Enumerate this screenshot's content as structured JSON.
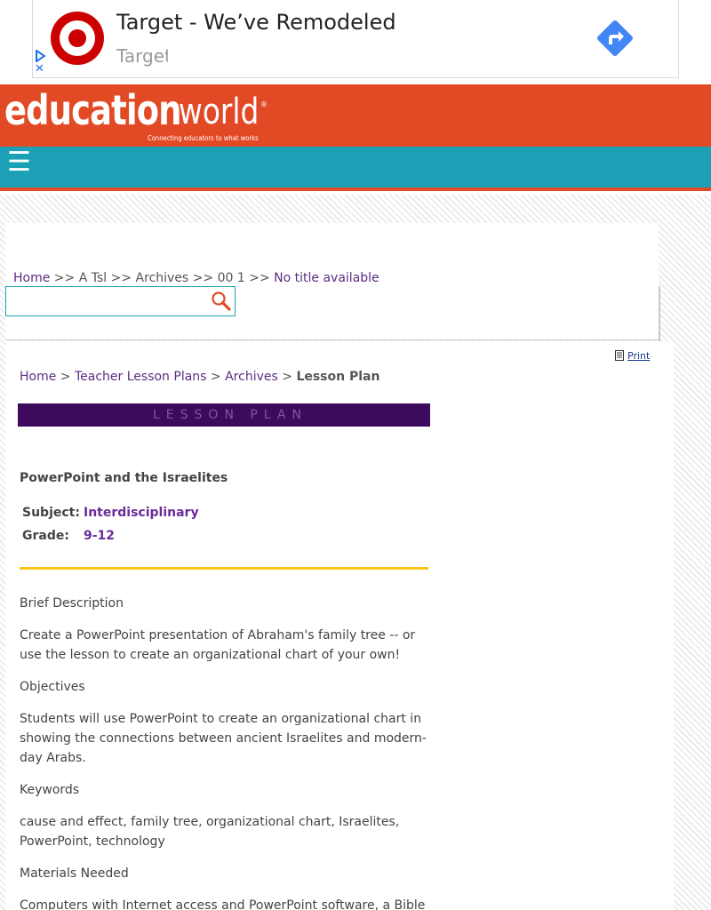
{
  "ad": {
    "title": "Target - We’ve Remodeled",
    "subtitle": "Target",
    "close_glyph": "✕",
    "brand_color": "#cc0000",
    "direction_color": "#4285f4"
  },
  "header": {
    "logo_primary": "education",
    "logo_secondary": "world",
    "logo_reg": "®",
    "tagline": "Connecting educators to what works",
    "menu_glyph": "☰"
  },
  "top_breadcrumb": {
    "home": "Home",
    "sep": ">>",
    "a_tsl": "A Tsl",
    "archives": "Archives",
    "section": "00 1",
    "current": "No title available"
  },
  "search": {
    "placeholder": ""
  },
  "print": {
    "label": "Print"
  },
  "breadcrumb": {
    "home": "Home",
    "sep": ">",
    "teacher_lesson_plans": "Teacher Lesson Plans",
    "archives": "Archives",
    "current": "Lesson Plan"
  },
  "banner": {
    "label": "LESSON PLAN"
  },
  "lesson": {
    "title": "PowerPoint and the Israelites",
    "subject_label": "Subject:",
    "subject_value": "Interdisciplinary",
    "grade_label": "Grade:",
    "grade_value": "9-12"
  },
  "sections": {
    "brief_heading": "Brief Description",
    "brief_text": "Create a PowerPoint presentation of Abraham's family tree -- or use the lesson to create an organizational chart of your own!",
    "objectives_heading": "Objectives",
    "objectives_text": "Students will use PowerPoint to create an organizational chart in showing the connections between ancient Israelites and modern-day Arabs.",
    "keywords_heading": "Keywords",
    "keywords_text": "cause and effect, family tree, organizational chart, Israelites, PowerPoint, technology",
    "materials_heading": "Materials Needed",
    "materials_text": "Computers with Internet access and PowerPoint software, a Bible"
  }
}
